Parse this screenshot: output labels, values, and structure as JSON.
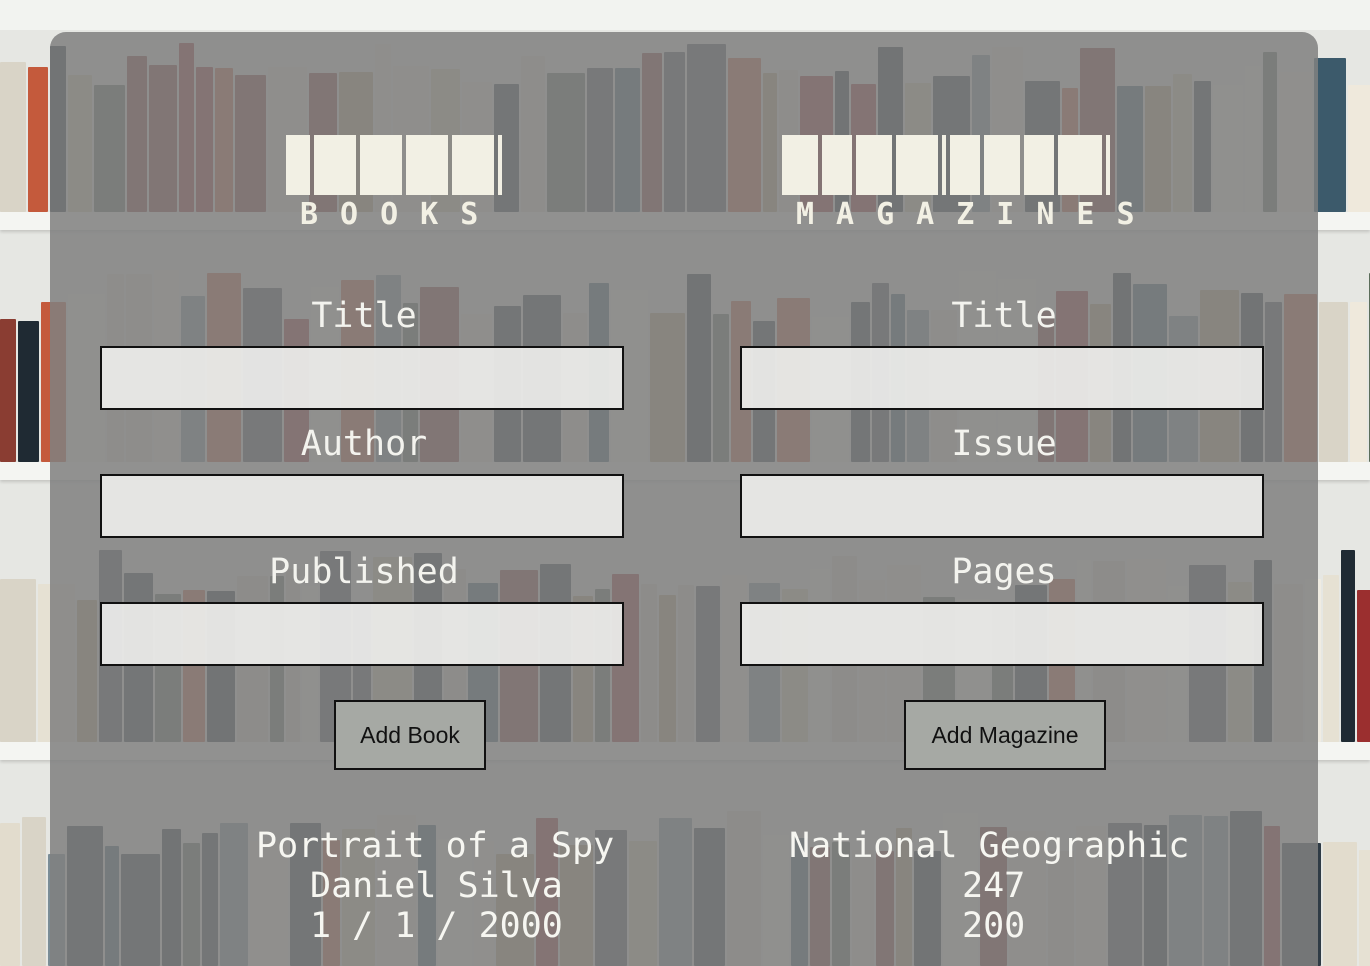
{
  "books": {
    "heading": "BOOKS",
    "fields": [
      {
        "label": "Title",
        "value": "",
        "placeholder": ""
      },
      {
        "label": "Author",
        "value": "",
        "placeholder": ""
      },
      {
        "label": "Published",
        "value": "",
        "placeholder": ""
      }
    ],
    "add_button_label": "Add Book",
    "entry": {
      "title": "Portrait of a Spy",
      "author": "Daniel Silva",
      "published": "1 / 1 / 2000"
    }
  },
  "magazines": {
    "heading": "MAGAZINES",
    "fields": [
      {
        "label": "Title",
        "value": "",
        "placeholder": ""
      },
      {
        "label": "Issue",
        "value": "",
        "placeholder": ""
      },
      {
        "label": "Pages",
        "value": "",
        "placeholder": ""
      }
    ],
    "add_button_label": "Add Magazine",
    "entry": {
      "title": "National Geographic",
      "issue": "247",
      "pages": "200"
    }
  },
  "colors": {
    "panel": "#808080",
    "logo": "#f2f0e4",
    "button": "#a6a9a4",
    "input": "#ececea"
  }
}
